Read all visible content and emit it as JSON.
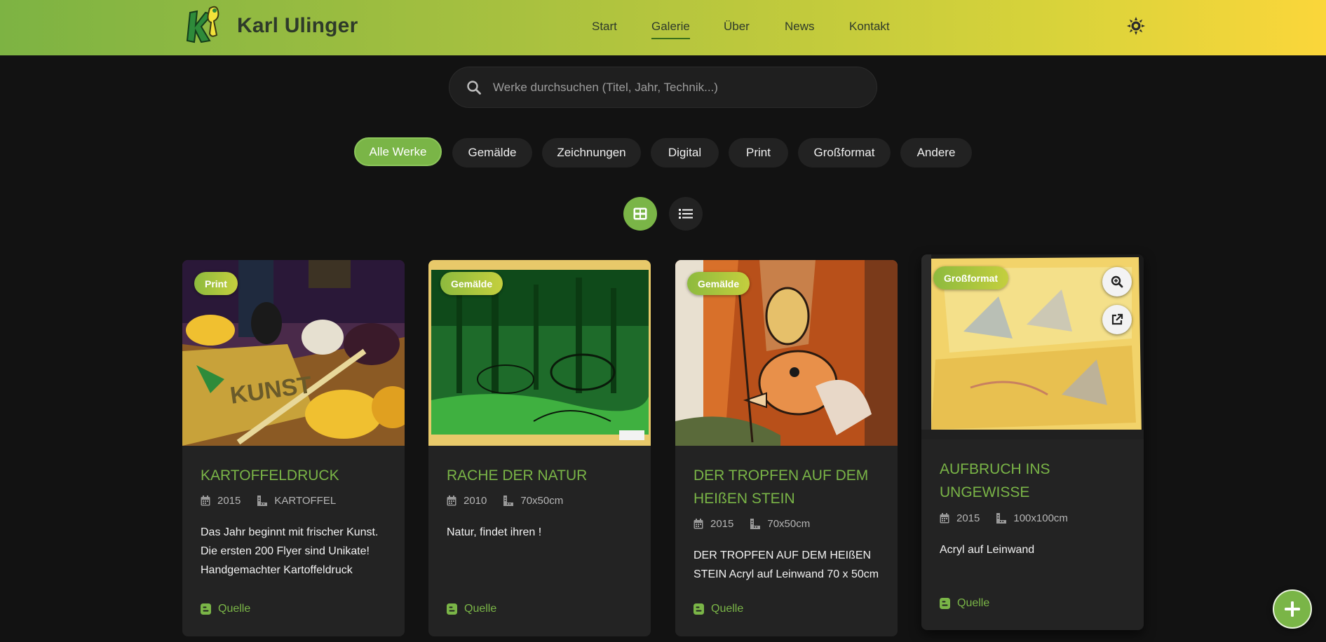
{
  "header": {
    "brand": "Karl Ulinger",
    "nav": [
      {
        "label": "Start"
      },
      {
        "label": "Galerie"
      },
      {
        "label": "Über"
      },
      {
        "label": "News"
      },
      {
        "label": "Kontakt"
      }
    ],
    "active_nav": "Galerie",
    "theme_icon": "sun-icon"
  },
  "search": {
    "placeholder": "Werke durchsuchen (Titel, Jahr, Technik...)",
    "value": ""
  },
  "filters": [
    {
      "label": "Alle Werke"
    },
    {
      "label": "Gemälde"
    },
    {
      "label": "Zeichnungen"
    },
    {
      "label": "Digital"
    },
    {
      "label": "Print"
    },
    {
      "label": "Großformat"
    },
    {
      "label": "Andere"
    }
  ],
  "active_filter": "Alle Werke",
  "view_modes": {
    "grid_icon": "grid-icon",
    "list_icon": "list-icon",
    "active": "grid"
  },
  "cards": [
    {
      "badge": "Print",
      "title": "KARTOFFELDRUCK",
      "year": "2015",
      "size": "KARTOFFEL",
      "description": "Das Jahr beginnt mit frischer Kunst. Die ersten 200 Flyer sind Unikate! Handgemachter Kartoffeldruck",
      "source_label": "Quelle"
    },
    {
      "badge": "Gemälde",
      "title": "RACHE DER NATUR",
      "year": "2010",
      "size": "70x50cm",
      "description": "Natur, findet ihren !",
      "source_label": "Quelle"
    },
    {
      "badge": "Gemälde",
      "title_lines": [
        "DER TROPFEN AUF DEM",
        "HEIßEN STEIN"
      ],
      "year": "2015",
      "size": "70x50cm",
      "description": "DER TROPFEN AUF DEM HEIßEN STEIN Acryl auf Leinwand 70 x 50cm",
      "source_label": "Quelle"
    },
    {
      "badge": "Großformat",
      "title_lines": [
        "AUFBRUCH INS",
        "UNGEWISSE"
      ],
      "year": "2015",
      "size": "100x100cm",
      "description": "Acryl auf Leinwand",
      "source_label": "Quelle",
      "hover_actions": [
        "zoom-icon",
        "external-link-icon"
      ]
    }
  ],
  "colors": {
    "accent": "#7ab547",
    "background": "#121212",
    "card": "#232323"
  },
  "fab_icon": "plus-icon"
}
